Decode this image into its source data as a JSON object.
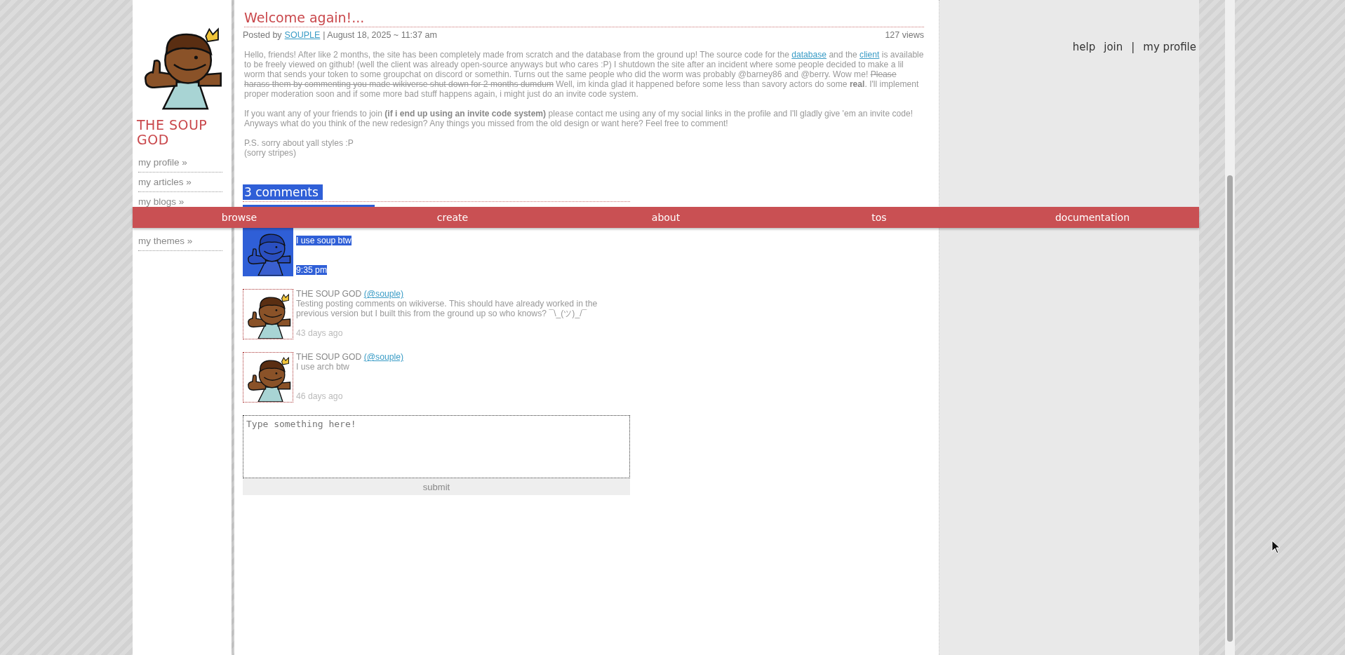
{
  "sidebar": {
    "title": "THE SOUP GOD",
    "items": [
      {
        "label": "my profile »"
      },
      {
        "label": "my articles »"
      },
      {
        "label": "my blogs »"
      },
      {
        "label": "my themes »"
      }
    ]
  },
  "header_links": [
    "help",
    "join",
    "|",
    "my profile"
  ],
  "nav": [
    "browse",
    "create",
    "about",
    "tos",
    "documentation"
  ],
  "post": {
    "title": "Welcome again!...",
    "posted_by_label": "Posted by",
    "author": "SOUPLE",
    "date": "| August 18, 2025 ~ 11:37 am",
    "views": "127 views",
    "paragraphs": [
      [
        {
          "kind": "plain",
          "text": "Hello, friends! After like 2 months, the site has been completely made from scratch and the database from the ground up! The source code for the "
        },
        {
          "kind": "link",
          "text": "database"
        },
        {
          "kind": "plain",
          "text": " and the "
        },
        {
          "kind": "link",
          "text": "client"
        },
        {
          "kind": "plain",
          "text": " is available to be freely viewed on github! (well the client was already open-source anyways but who cares :P) I shutdown the site after an incident where some people decided to make a lil worm that sends your token to some groupchat on discord or somethin. Turns out the same people who did the worm was probably @barney86 and @berry. Wow me! "
        },
        {
          "kind": "strike",
          "text": "Please harass them by commenting you made wikiverse shut down for 2 months dumdum"
        },
        {
          "kind": "plain",
          "text": " Well, im kinda glad it happened before some less than savory actors do some "
        },
        {
          "kind": "bold",
          "text": "real"
        },
        {
          "kind": "plain",
          "text": ". I'll implement proper moderation soon and if some more bad stuff happens again, i might just do an invite code system."
        }
      ],
      [
        {
          "kind": "plain",
          "text": "If you want any of your friends to join "
        },
        {
          "kind": "bold",
          "text": "(if i end up using an invite code system)"
        },
        {
          "kind": "plain",
          "text": " please contact me using any of my social links in the profile and I'll gladly give 'em an invite code! Anyways what do you think of the new redesign? Any things you missed from the old design or want here? Feel free to comment!"
        }
      ],
      [
        {
          "kind": "plain",
          "text": "P.S. sorry about yall styles :P"
        },
        {
          "kind": "break"
        },
        {
          "kind": "plain",
          "text": "(sorry stripes)"
        }
      ]
    ]
  },
  "comments_heading": {
    "text": "3 comments",
    "highlighted": true
  },
  "comments": [
    {
      "text": "I use soup btw",
      "time": "9:35 pm",
      "highlighted": true
    },
    {
      "author": "THE SOUP GOD",
      "handle": "(@souple)",
      "text": "Testing posting comments on wikiverse. This should have already worked in the previous version but I built this from the ground up so who knows? ¯\\_(ツ)_/¯",
      "time": "43 days ago",
      "highlighted": false
    },
    {
      "author": "THE SOUP GOD",
      "handle": "(@souple)",
      "text": "I use arch btw",
      "time": "46 days ago",
      "highlighted": false
    }
  ],
  "comment_form": {
    "placeholder": "Type something here!",
    "submit": "submit"
  }
}
